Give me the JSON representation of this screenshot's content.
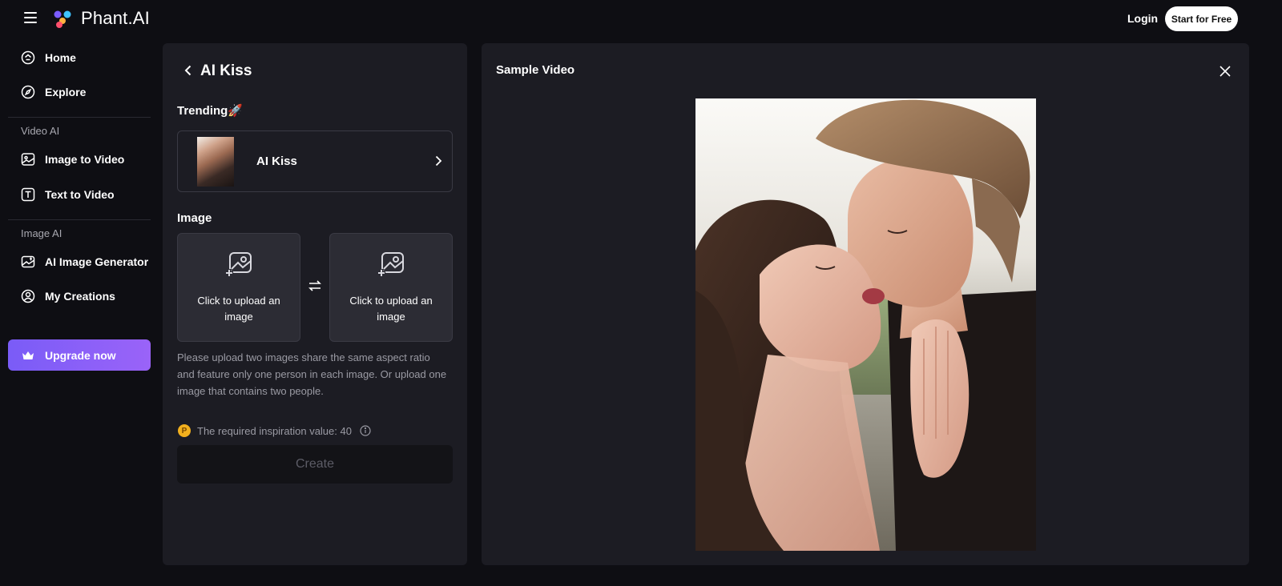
{
  "header": {
    "brand": "Phant.AI",
    "login_label": "Login",
    "start_label": "Start for Free"
  },
  "sidebar": {
    "items": [
      {
        "label": "Home",
        "icon": "home-icon"
      },
      {
        "label": "Explore",
        "icon": "compass-icon"
      }
    ],
    "video_section": "Video AI",
    "video_items": [
      {
        "label": "Image to Video",
        "icon": "image-icon"
      },
      {
        "label": "Text to Video",
        "icon": "text-icon"
      }
    ],
    "image_section": "Image AI",
    "image_items": [
      {
        "label": "AI Image Generator",
        "icon": "image-sparkle-icon"
      },
      {
        "label": "My Creations",
        "icon": "user-circle-icon"
      }
    ],
    "upgrade_label": "Upgrade now"
  },
  "panel": {
    "title": "AI Kiss",
    "trending_label": "Trending🚀",
    "trend_card_name": "AI Kiss",
    "image_label": "Image",
    "upload_left": "Click to upload an image",
    "upload_right": "Click to upload an image",
    "hint": "Please upload two images share the same aspect ratio and feature only one person in each image. Or upload one image that contains two people.",
    "inspiration_text": "The required inspiration value: 40",
    "coin_symbol": "P",
    "create_label": "Create"
  },
  "preview": {
    "title": "Sample Video"
  },
  "colors": {
    "background": "#0e0e13",
    "panel": "#1c1c23",
    "accent_start": "#7a5cf7",
    "accent_end": "#9a63f8",
    "coin": "#f2b01e"
  }
}
